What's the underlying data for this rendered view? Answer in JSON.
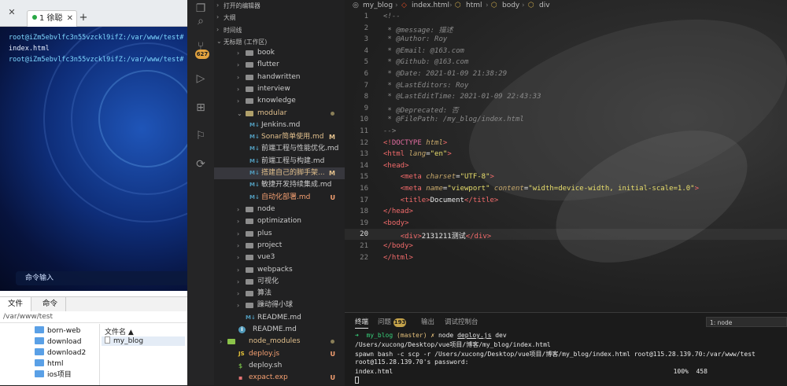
{
  "ssh_client": {
    "tab_label": "1 徐聪",
    "tab_close": "✕",
    "add_tab": "+",
    "terminal_lines": [
      {
        "prompt": "root@iZm5ebvlfc3n55vzckl9ifZ:/var/www/test#",
        "cmd": " ls"
      },
      {
        "prompt": "",
        "cmd": "index.html"
      },
      {
        "prompt": "root@iZm5ebvlfc3n55vzckl9ifZ:/var/www/test#",
        "cmd": " "
      }
    ],
    "command_input_placeholder": "命令输入",
    "bottom_tabs": [
      "文件",
      "命令"
    ],
    "path": "/var/www/test",
    "tree": [
      "born-web",
      "download",
      "download2",
      "html",
      "ios项目"
    ],
    "file_column_header": "文件名 ▲",
    "files": [
      "my_blog"
    ]
  },
  "activity_bar": {
    "icons": [
      "files-icon",
      "search-icon",
      "source-control-icon",
      "run-debug-icon",
      "extensions-icon",
      "bookmark-icon",
      "remote-icon"
    ],
    "scm_badge": "627"
  },
  "sidebar": {
    "sections": [
      "打开的编辑器",
      "大纲",
      "时间线",
      "无标题 (工作区)"
    ],
    "rows": [
      {
        "label": "book",
        "type": "folder"
      },
      {
        "label": "flutter",
        "type": "folder"
      },
      {
        "label": "handwritten",
        "type": "folder"
      },
      {
        "label": "interview",
        "type": "folder"
      },
      {
        "label": "knowledge",
        "type": "folder"
      },
      {
        "label": "modular",
        "type": "folder-open",
        "status": "dot"
      },
      {
        "label": "Jenkins.md",
        "type": "md"
      },
      {
        "label": "Sonar简单使用.md",
        "type": "md",
        "status": "M"
      },
      {
        "label": "前端工程与性能优化.md",
        "type": "md"
      },
      {
        "label": "前端工程与构建.md",
        "type": "md"
      },
      {
        "label": "搭建自己的脚手架...",
        "type": "md",
        "status": "M"
      },
      {
        "label": "敏捷开发持续集成.md",
        "type": "md"
      },
      {
        "label": "自动化部署.md",
        "type": "md",
        "status": "U"
      },
      {
        "label": "node",
        "type": "folder"
      },
      {
        "label": "optimization",
        "type": "folder"
      },
      {
        "label": "plus",
        "type": "folder"
      },
      {
        "label": "project",
        "type": "folder"
      },
      {
        "label": "vue3",
        "type": "folder"
      },
      {
        "label": "webpacks",
        "type": "folder"
      },
      {
        "label": "可视化",
        "type": "folder"
      },
      {
        "label": "算法",
        "type": "folder"
      },
      {
        "label": "躁动得小球",
        "type": "folder"
      },
      {
        "label": "README.md",
        "type": "md-inner"
      },
      {
        "label": "README.md",
        "type": "info"
      },
      {
        "label": "node_modules",
        "type": "node_modules"
      },
      {
        "label": "deploy.js",
        "type": "js",
        "status": "U"
      },
      {
        "label": "deploy.sh",
        "type": "sh"
      },
      {
        "label": "expact.exp",
        "type": "exp",
        "status": "U"
      }
    ]
  },
  "editor": {
    "breadcrumbs": [
      "my_blog",
      "index.html",
      "html",
      "body",
      "div"
    ],
    "current_line": 20,
    "line_numbers": [
      1,
      2,
      3,
      4,
      5,
      6,
      7,
      8,
      9,
      10,
      11,
      12,
      13,
      14,
      15,
      16,
      17,
      18,
      19,
      20,
      21,
      22
    ],
    "code_lines": [
      [
        [
          "cmt",
          "<!--"
        ]
      ],
      [
        [
          "cmt",
          " * @message: 描述"
        ]
      ],
      [
        [
          "cmt",
          " * @Author: Roy"
        ]
      ],
      [
        [
          "cmt",
          " * @Email: @163.com"
        ]
      ],
      [
        [
          "cmt",
          " * @Github: @163.com"
        ]
      ],
      [
        [
          "cmt",
          " * @Date: 2021-01-09 21:38:29"
        ]
      ],
      [
        [
          "cmt",
          " * @LastEditors: Roy"
        ]
      ],
      [
        [
          "cmt",
          " * @LastEditTime: 2021-01-09 22:43:33"
        ]
      ],
      [
        [
          "cmt",
          " * @Deprecated: 否"
        ]
      ],
      [
        [
          "cmt",
          " * @FilePath: /my_blog/index.html"
        ]
      ],
      [
        [
          "cmt",
          "-->"
        ]
      ],
      [
        [
          "tag",
          "<!"
        ],
        [
          "kw",
          "DOCTYPE"
        ],
        [
          "txt",
          " "
        ],
        [
          "attr",
          "html"
        ],
        [
          "tag",
          ">"
        ]
      ],
      [
        [
          "tag",
          "<html"
        ],
        [
          "txt",
          " "
        ],
        [
          "attr",
          "lang"
        ],
        [
          "txt",
          "="
        ],
        [
          "str",
          "\"en\""
        ],
        [
          "tag",
          ">"
        ]
      ],
      [
        [
          "tag",
          "<head>"
        ]
      ],
      [
        [
          "txt",
          "    "
        ],
        [
          "tag",
          "<meta"
        ],
        [
          "txt",
          " "
        ],
        [
          "attr",
          "charset"
        ],
        [
          "txt",
          "="
        ],
        [
          "str",
          "\"UTF-8\""
        ],
        [
          "tag",
          ">"
        ]
      ],
      [
        [
          "txt",
          "    "
        ],
        [
          "tag",
          "<meta"
        ],
        [
          "txt",
          " "
        ],
        [
          "attr",
          "name"
        ],
        [
          "txt",
          "="
        ],
        [
          "str",
          "\"viewport\""
        ],
        [
          "txt",
          " "
        ],
        [
          "attr",
          "content"
        ],
        [
          "txt",
          "="
        ],
        [
          "str",
          "\"width=device-width, initial-scale=1.0\""
        ],
        [
          "tag",
          ">"
        ]
      ],
      [
        [
          "txt",
          "    "
        ],
        [
          "tag",
          "<title>"
        ],
        [
          "txt",
          "Document"
        ],
        [
          "tag",
          "</title>"
        ]
      ],
      [
        [
          "tag",
          "</head>"
        ]
      ],
      [
        [
          "tag",
          "<body>"
        ]
      ],
      [
        [
          "txt",
          "    "
        ],
        [
          "tag",
          "<div>"
        ],
        [
          "txt",
          "2131211测试"
        ],
        [
          "tag",
          "</div>"
        ]
      ],
      [
        [
          "tag",
          "</body>"
        ]
      ],
      [
        [
          "tag",
          "</html>"
        ]
      ]
    ]
  },
  "panel": {
    "tabs": [
      "终端",
      "问题",
      "输出",
      "调试控制台"
    ],
    "problems_count": "193",
    "terminal_select": "1: node",
    "lines": [
      [
        [
          "green",
          "➜  my_blog "
        ],
        [
          "yellow",
          "(master) ✗ "
        ],
        [
          "txt",
          "node "
        ],
        [
          "ul",
          "deploy.js"
        ],
        [
          "txt",
          " dev"
        ]
      ],
      [
        [
          "txt",
          "/Users/xucong/Desktop/vue项目/博客/my_blog/index.html"
        ]
      ],
      [
        [
          "txt",
          "spawn bash -c scp -r /Users/xucong/Desktop/vue项目/博客/my_blog/index.html root@115.28.139.70:/var/www/test"
        ]
      ],
      [
        [
          "txt",
          "root@115.28.139.70's password:"
        ]
      ],
      [
        [
          "txt",
          "index.html                                                                          100%  458"
        ]
      ]
    ]
  }
}
